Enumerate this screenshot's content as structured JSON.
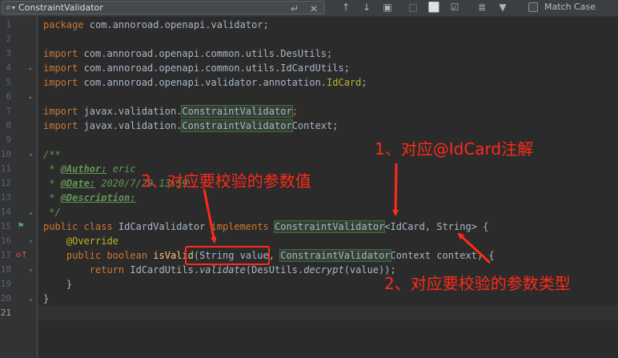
{
  "search": {
    "value": "ConstraintValidator",
    "match_case_label": "Match Case"
  },
  "colors": {
    "annotation_arrow": "#ff2a1a",
    "editor_bg": "#2b2b2b",
    "keyword": "#cc7832",
    "doc_comment": "#629755"
  },
  "line_numbers": [
    "1",
    "2",
    "3",
    "4",
    "5",
    "6",
    "7",
    "8",
    "9",
    "10",
    "11",
    "12",
    "13",
    "14",
    "15",
    "16",
    "17",
    "18",
    "19",
    "20",
    "21"
  ],
  "code": {
    "l1_kw": "package",
    "l1_rest": " com.annoroad.openapi.validator;",
    "l3_kw": "import",
    "l3_rest": " com.annoroad.openapi.common.utils.DesUtils;",
    "l4_kw": "import",
    "l4_rest": " com.annoroad.openapi.common.utils.IdCardUtils;",
    "l5_kw": "import",
    "l5_rest_a": " com.annoroad.openapi.validator.annotation.",
    "l5_ann": "IdCard",
    "l5_rest_b": ";",
    "l7_kw": "import",
    "l7_rest_a": " javax.validation.",
    "l7_hl": "ConstraintValidator",
    "l7_rest_b": ";",
    "l8_kw": "import",
    "l8_rest_a": " javax.validation.",
    "l8_hl": "ConstraintValidator",
    "l8_rest_b": "Context;",
    "l10": "/**",
    "l11_star": " * ",
    "l11_tag": "@Author:",
    "l11_val": " eric",
    "l12_star": " * ",
    "l12_tag": "@Date:",
    "l12_val": " 2020/7/29 13:59",
    "l13_star": " * ",
    "l13_tag": "@Description:",
    "l14": " */",
    "l15_kw": "public class",
    "l15_name": " IdCardValidator ",
    "l15_kw2": "implements",
    "l15_sp": " ",
    "l15_hl": "ConstraintValidator",
    "l15_lt": "<",
    "l15_idcard": "IdCard",
    "l15_rest": ", String> {",
    "l16_indent": "    ",
    "l16_ann": "@Override",
    "l17_indent": "    ",
    "l17_kw": "public boolean",
    "l17_sp": " ",
    "l17_method": "isValid",
    "l17_a": "(String value, ",
    "l17_hl": "ConstraintValidator",
    "l17_b": "Context context) {",
    "l18_indent": "        ",
    "l18_kw": "return",
    "l18_a": " IdCardUtils.",
    "l18_m1": "validate",
    "l18_b": "(DesUtils.",
    "l18_m2": "decrypt",
    "l18_c": "(value));",
    "l19": "    }",
    "l20": "}"
  },
  "annotations": {
    "note1": "1、对应@IdCard注解",
    "note2": "2、对应要校验的参数类型",
    "note3": "3、对应要校验的参数值"
  }
}
